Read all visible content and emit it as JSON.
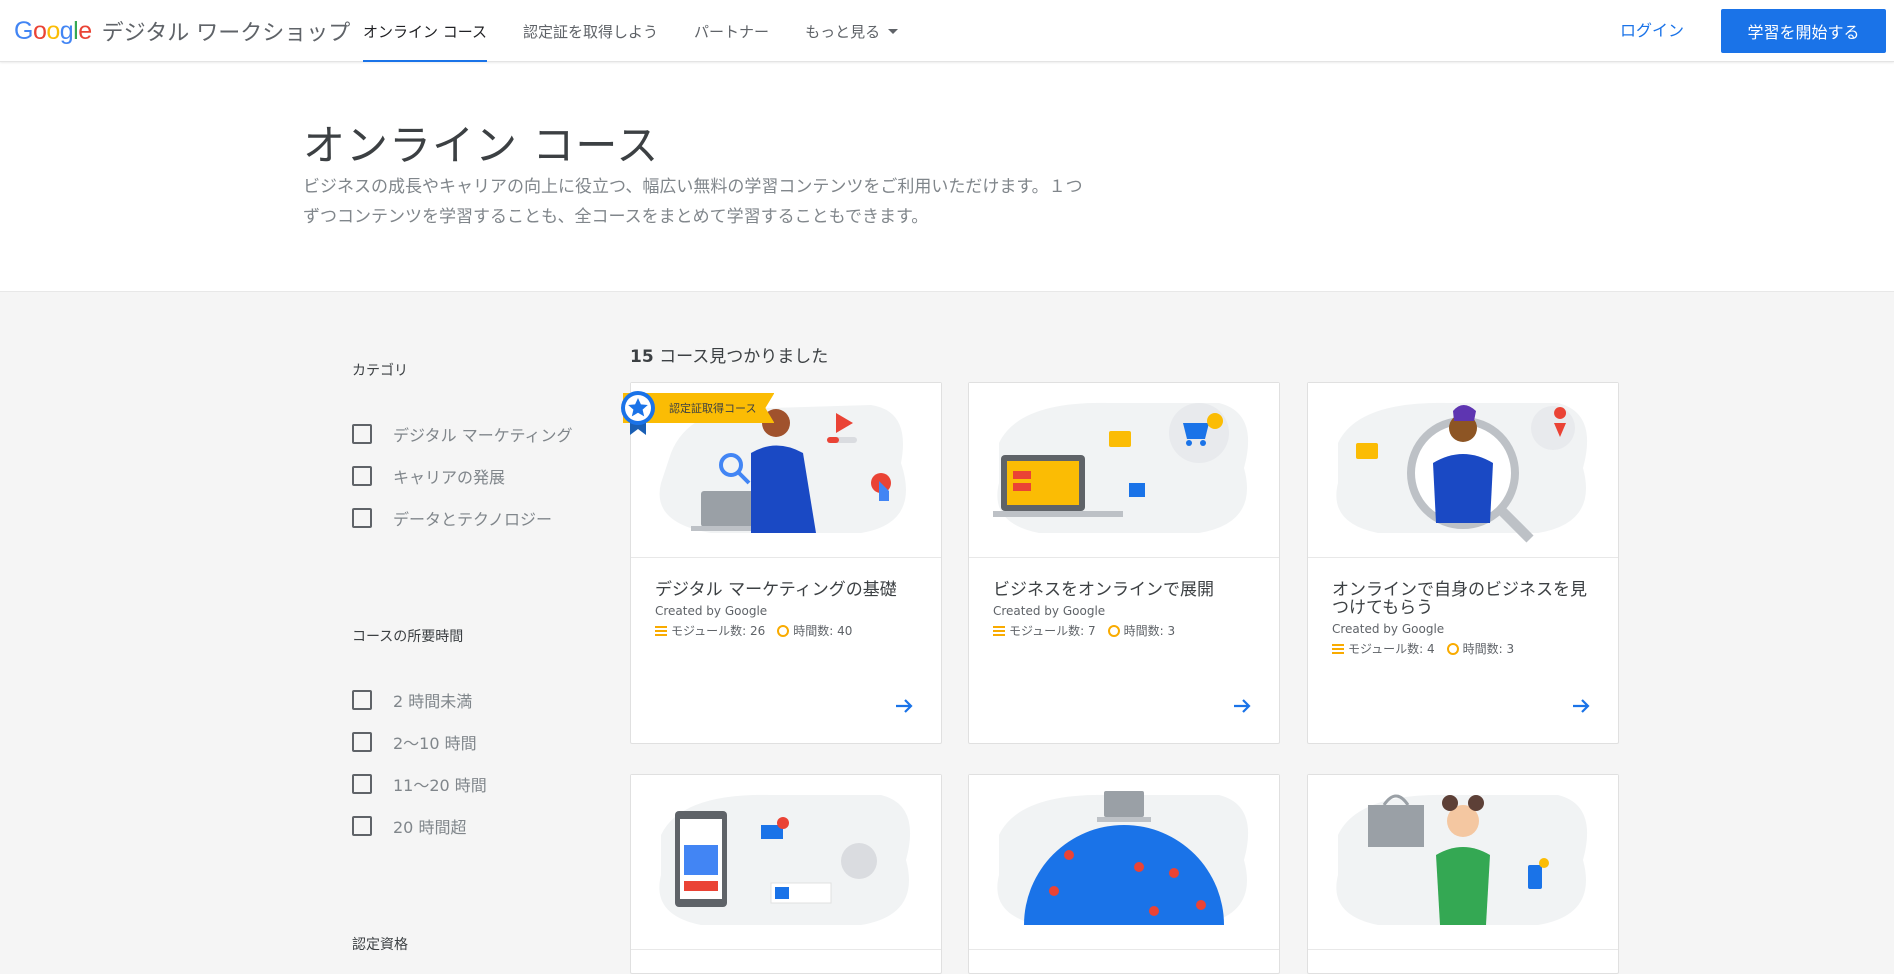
{
  "header": {
    "logo_brand": "Google",
    "logo_product": "デジタル ワークショップ",
    "nav": [
      {
        "label": "オンライン コース"
      },
      {
        "label": "認定証を取得しよう"
      },
      {
        "label": "パートナー"
      },
      {
        "label": "もっと見る"
      }
    ],
    "login_label": "ログイン",
    "start_label": "学習を開始する"
  },
  "hero": {
    "title": "オンライン コース",
    "description": "ビジネスの成長やキャリアの向上に役立つ、幅広い無料の学習コンテンツをご利用いただけます。１つずつコンテンツを学習することも、全コースをまとめて学習することもできます。"
  },
  "filters": {
    "category": {
      "title": "カテゴリ",
      "options": [
        "デジタル マーケティング",
        "キャリアの発展",
        "データとテクノロジー"
      ]
    },
    "duration": {
      "title": "コースの所要時間",
      "options": [
        "2 時間未満",
        "2〜10 時間",
        "11〜20 時間",
        "20 時間超"
      ]
    },
    "certification": {
      "title": "認定資格"
    }
  },
  "results": {
    "count": "15",
    "suffix": " コース見つかりました"
  },
  "courses": [
    {
      "title": "デジタル マーケティングの基礎",
      "creator": "Created by Google",
      "modules": "モジュール数: 26",
      "hours": "時間数: 40",
      "badge": "認定証取得コース"
    },
    {
      "title": "ビジネスをオンラインで展開",
      "creator": "Created by Google",
      "modules": "モジュール数: 7",
      "hours": "時間数: 3"
    },
    {
      "title": "オンラインで自身のビジネスを見つけてもらう",
      "creator": "Created by Google",
      "modules": "モジュール数: 4",
      "hours": "時間数: 3"
    }
  ],
  "colors": {
    "accent": "#1a73e8",
    "badge": "#fbbc04",
    "meta_icon": "#f9ab00"
  },
  "icons": [
    "caret-down-icon",
    "arrow-right-icon",
    "modules-icon",
    "clock-icon",
    "medal-icon"
  ]
}
